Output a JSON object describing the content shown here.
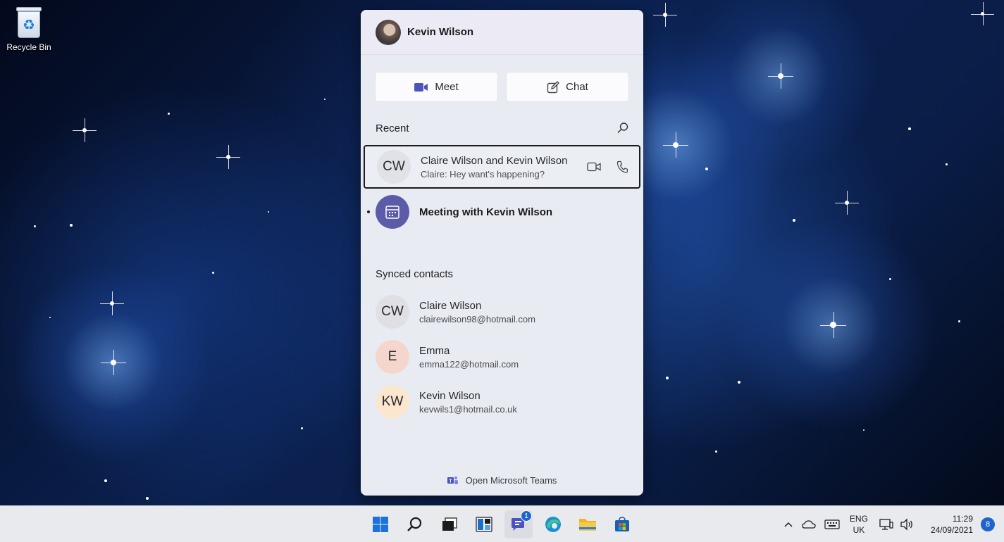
{
  "desktop": {
    "recycle_bin_label": "Recycle Bin"
  },
  "chat_flyout": {
    "user_name": "Kevin Wilson",
    "meet_label": "Meet",
    "chat_label": "Chat",
    "recent_heading": "Recent",
    "recent": [
      {
        "initials": "CW",
        "title": "Claire Wilson and Kevin Wilson",
        "preview": "Claire: Hey want's happening?"
      },
      {
        "title": "Meeting with Kevin Wilson",
        "icon": "calendar-icon"
      }
    ],
    "synced_heading": "Synced contacts",
    "contacts": [
      {
        "initials": "CW",
        "name": "Claire Wilson",
        "email": "clairewilson98@hotmail.com",
        "color": "#e0e0e4"
      },
      {
        "initials": "E",
        "name": "Emma",
        "email": "emma122@hotmail.com",
        "color": "#f5d6cd"
      },
      {
        "initials": "KW",
        "name": "Kevin Wilson",
        "email": "kevwils1@hotmail.co.uk",
        "color": "#fbe7cf"
      }
    ],
    "open_teams_label": "Open Microsoft Teams"
  },
  "taskbar": {
    "apps": [
      "start-icon",
      "search-icon",
      "task-view-icon",
      "widgets-icon",
      "teams-chat-icon",
      "edge-icon",
      "file-explorer-icon",
      "store-icon"
    ],
    "chat_badge": "1",
    "lang_top": "ENG",
    "lang_bottom": "UK",
    "time": "11:29",
    "date": "24/09/2021",
    "notification_count": "8"
  },
  "colors": {
    "meeting_avatar": "#5b5ba8",
    "accent": "#1f65c9",
    "teams_purple": "#4b53bc"
  }
}
